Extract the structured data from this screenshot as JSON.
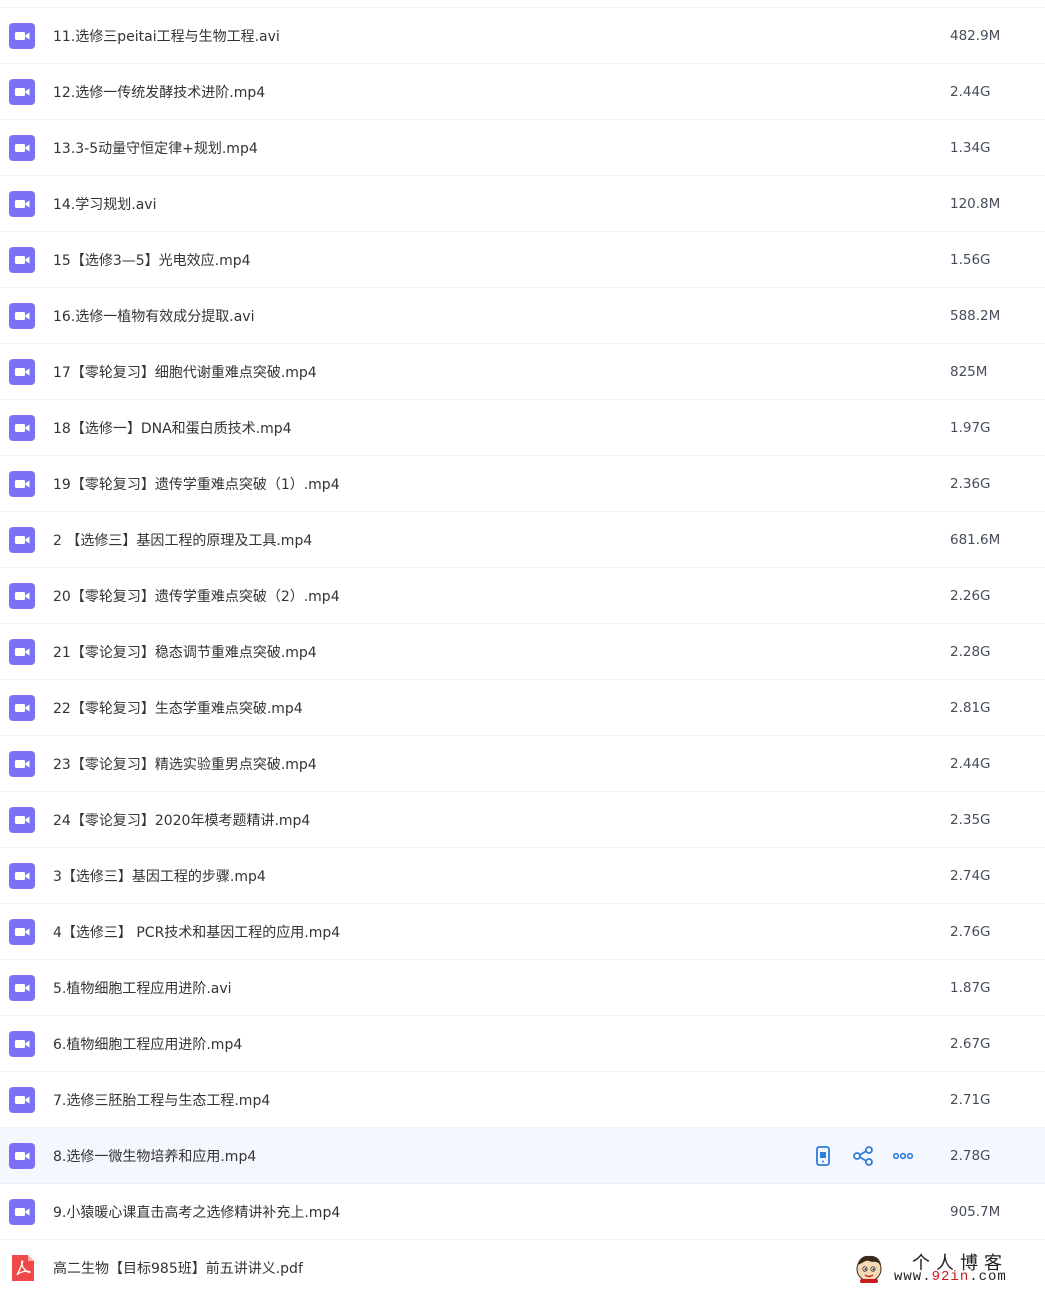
{
  "colors": {
    "video_icon": "#7b70f6",
    "pdf_icon": "#f04848",
    "action_icon": "#2e7dd8",
    "row_divider": "#eef0f4",
    "hover_background": "#f5f7ff"
  },
  "files": [
    {
      "name": "11.选修三peitai工程与生物工程.avi",
      "size": "482.9M",
      "type": "video",
      "icon": "video-icon"
    },
    {
      "name": "12.选修一传统发酵技术进阶.mp4",
      "size": "2.44G",
      "type": "video",
      "icon": "video-icon"
    },
    {
      "name": "13.3-5动量守恒定律+规划.mp4",
      "size": "1.34G",
      "type": "video",
      "icon": "video-icon"
    },
    {
      "name": "14.学习规划.avi",
      "size": "120.8M",
      "type": "video",
      "icon": "video-icon"
    },
    {
      "name": "15【选修3—5】光电效应.mp4",
      "size": "1.56G",
      "type": "video",
      "icon": "video-icon"
    },
    {
      "name": "16.选修一植物有效成分提取.avi",
      "size": "588.2M",
      "type": "video",
      "icon": "video-icon"
    },
    {
      "name": "17【零轮复习】细胞代谢重难点突破.mp4",
      "size": "825M",
      "type": "video",
      "icon": "video-icon"
    },
    {
      "name": "18【选修一】DNA和蛋白质技术.mp4",
      "size": "1.97G",
      "type": "video",
      "icon": "video-icon"
    },
    {
      "name": "19【零轮复习】遗传学重难点突破（1）.mp4",
      "size": "2.36G",
      "type": "video",
      "icon": "video-icon"
    },
    {
      "name": "2 【选修三】基因工程的原理及工具.mp4",
      "size": "681.6M",
      "type": "video",
      "icon": "video-icon"
    },
    {
      "name": "20【零轮复习】遗传学重难点突破（2）.mp4",
      "size": "2.26G",
      "type": "video",
      "icon": "video-icon"
    },
    {
      "name": "21【零论复习】稳态调节重难点突破.mp4",
      "size": "2.28G",
      "type": "video",
      "icon": "video-icon"
    },
    {
      "name": "22【零轮复习】生态学重难点突破.mp4",
      "size": "2.81G",
      "type": "video",
      "icon": "video-icon"
    },
    {
      "name": "23【零论复习】精选实验重男点突破.mp4",
      "size": "2.44G",
      "type": "video",
      "icon": "video-icon"
    },
    {
      "name": "24【零论复习】2020年模考题精讲.mp4",
      "size": "2.35G",
      "type": "video",
      "icon": "video-icon"
    },
    {
      "name": "3【选修三】基因工程的步骤.mp4",
      "size": "2.74G",
      "type": "video",
      "icon": "video-icon"
    },
    {
      "name": "4【选修三】 PCR技术和基因工程的应用.mp4",
      "size": "2.76G",
      "type": "video",
      "icon": "video-icon"
    },
    {
      "name": "5.植物细胞工程应用进阶.avi",
      "size": "1.87G",
      "type": "video",
      "icon": "video-icon"
    },
    {
      "name": "6.植物细胞工程应用进阶.mp4",
      "size": "2.67G",
      "type": "video",
      "icon": "video-icon"
    },
    {
      "name": "7.选修三胚胎工程与生态工程.mp4",
      "size": "2.71G",
      "type": "video",
      "icon": "video-icon"
    },
    {
      "name": "8.选修一微生物培养和应用.mp4",
      "size": "2.78G",
      "type": "video",
      "icon": "video-icon",
      "hovered": true,
      "actions": [
        {
          "name": "phone-icon"
        },
        {
          "name": "share-icon"
        },
        {
          "name": "more-icon"
        }
      ]
    },
    {
      "name": "9.小猿暖心课直击高考之选修精讲补充上.mp4",
      "size": "905.7M",
      "type": "video",
      "icon": "video-icon"
    },
    {
      "name": "高二生物【目标985班】前五讲讲义.pdf",
      "size": "",
      "type": "pdf",
      "icon": "pdf-icon"
    }
  ],
  "watermark": {
    "title": "个人博客",
    "url_prefix": "www.",
    "url_accent": "92in",
    "url_suffix": ".com",
    "avatar_icon": "cartoon-avatar-icon"
  }
}
